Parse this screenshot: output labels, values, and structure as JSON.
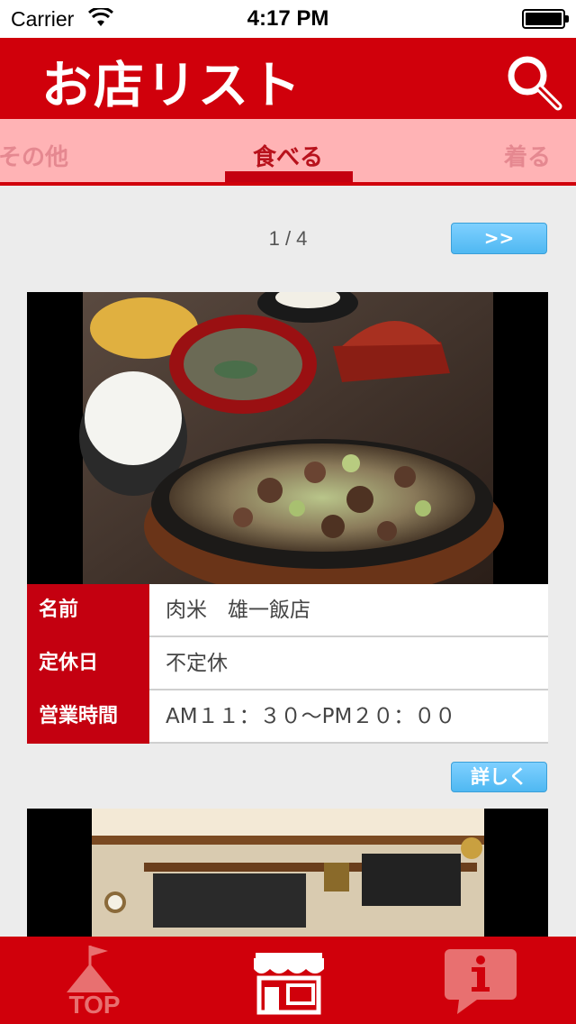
{
  "status_bar": {
    "carrier": "Carrier",
    "time": "4:17 PM"
  },
  "header": {
    "title": "お店リスト",
    "search_icon": "search-icon"
  },
  "tabs": [
    {
      "label": "その他",
      "selected": false
    },
    {
      "label": "食べる",
      "selected": true
    },
    {
      "label": "着る",
      "selected": false
    }
  ],
  "pagination": {
    "indicator": "1 / 4",
    "next_label": ">>"
  },
  "shop": {
    "rows": [
      {
        "label": "名前",
        "value": "肉米　雄一飯店"
      },
      {
        "label": "定休日",
        "value": "不定休"
      },
      {
        "label": "営業時間",
        "value": "AM１１：３０～PM２０：００"
      }
    ],
    "detail_label": "詳しく"
  },
  "tabbar": {
    "items": [
      {
        "icon": "top-flag-icon",
        "label": "TOP"
      },
      {
        "icon": "shop-icon"
      },
      {
        "icon": "info-icon"
      }
    ]
  },
  "colors": {
    "primary": "#d0000b",
    "tab_bg": "#ffb3b5",
    "button": "#5ac0f5"
  }
}
